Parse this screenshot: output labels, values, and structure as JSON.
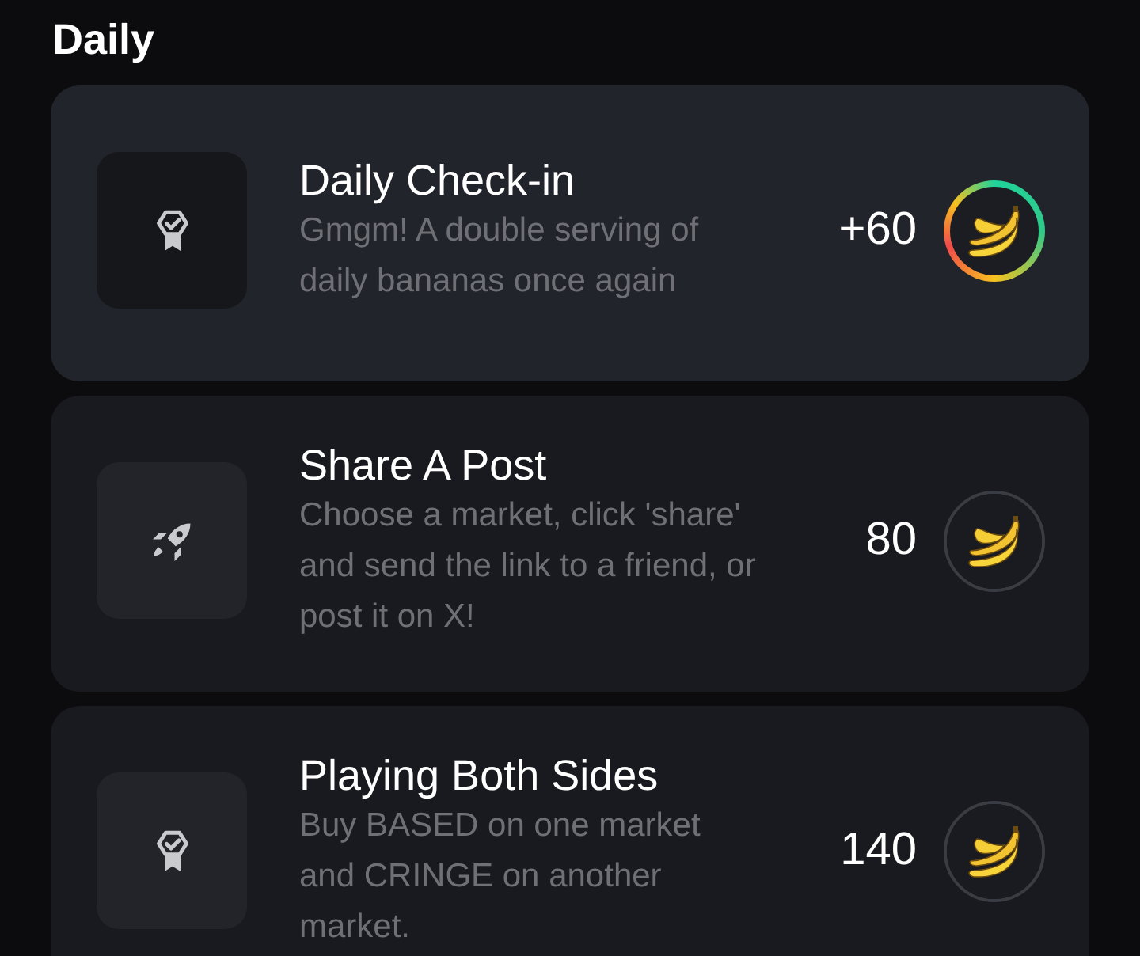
{
  "section_title": "Daily",
  "tasks": [
    {
      "kind": "badge",
      "title": "Daily Check-in",
      "description": "Gmgm! A double serving of daily bananas once again",
      "reward": "+60",
      "highlighted": true
    },
    {
      "kind": "rocket",
      "title": "Share A Post",
      "description": "Choose a market, click 'share' and send the link to a friend, or post it on X!",
      "reward": "80",
      "highlighted": false
    },
    {
      "kind": "badge",
      "title": "Playing Both Sides",
      "description": "Buy BASED on one market and CRINGE on another market.",
      "reward": "140",
      "highlighted": false
    }
  ]
}
